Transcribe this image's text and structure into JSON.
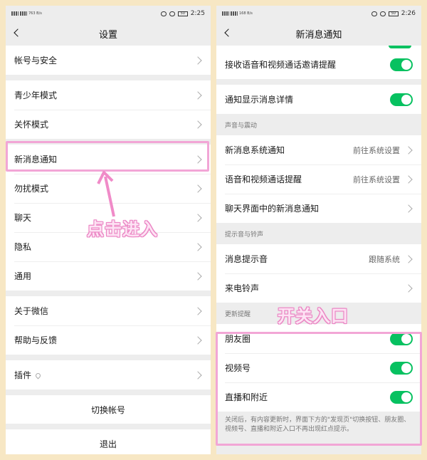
{
  "colors": {
    "accent": "#07c160",
    "highlight": "#f2a6d6",
    "background": "#f7e7c4"
  },
  "left": {
    "status": {
      "speed": "763 B/s",
      "battery": "50",
      "time": "2:25"
    },
    "title": "设置",
    "items": {
      "account": "帐号与安全",
      "youth": "青少年模式",
      "care": "关怀模式",
      "new_msg": "新消息通知",
      "dnd": "勿扰模式",
      "chat": "聊天",
      "privacy": "隐私",
      "general": "通用",
      "about": "关于微信",
      "help": "帮助与反馈",
      "plugins": "插件"
    },
    "switch_account": "切换帐号",
    "logout": "退出",
    "annotation": "点击进入"
  },
  "right": {
    "status": {
      "speed": "168 B/s",
      "battery": "50",
      "time": "2:26"
    },
    "title": "新消息通知",
    "call_invite": "接收语音和视频通话邀请提醒",
    "show_detail": "通知显示消息详情",
    "section_sound": "声音与震动",
    "sys_notify": {
      "label": "新消息系统通知",
      "value": "前往系统设置"
    },
    "call_remind": {
      "label": "语音和视频通话提醒",
      "value": "前往系统设置"
    },
    "chat_notify": "聊天界面中的新消息通知",
    "section_ring": "提示音与铃声",
    "msg_tone": {
      "label": "消息提示音",
      "value": "跟随系统"
    },
    "ringtone": "来电铃声",
    "section_update": "更新提醒",
    "moments": "朋友圈",
    "channels": "视频号",
    "live": "直播和附近",
    "note": "关闭后，有内容更新时，界面下方的\"发现页\"切换按钮、朋友圈、视频号、直播和附近入口不再出现红点提示。",
    "annotation": "开关入口"
  }
}
